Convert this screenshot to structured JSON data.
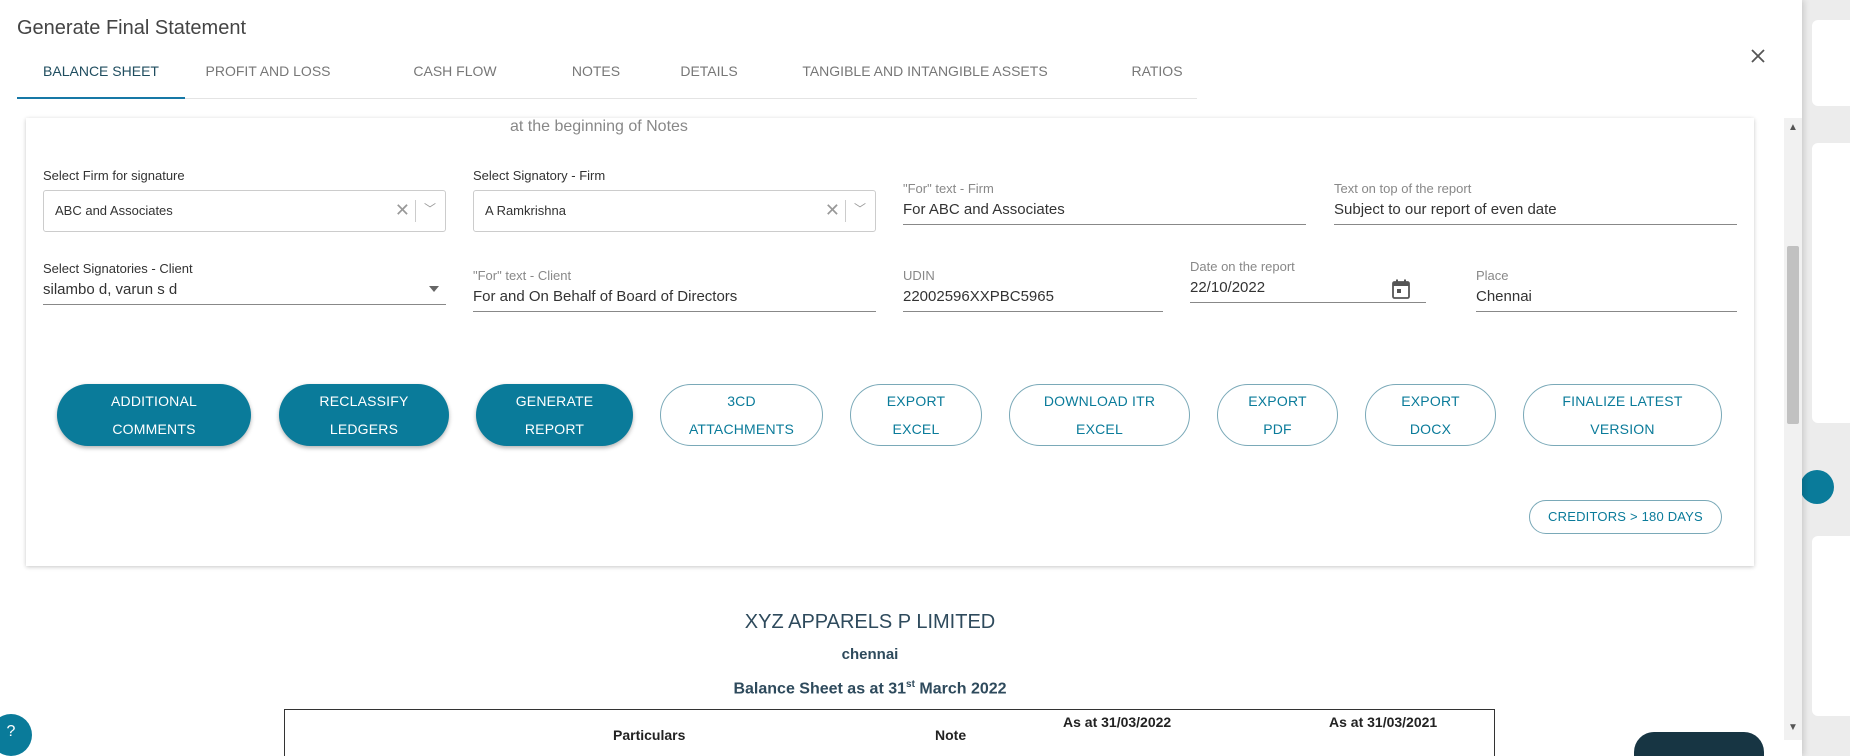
{
  "dialog": {
    "title": "Generate Final Statement",
    "close_icon": "close-icon"
  },
  "tabs": [
    {
      "label": "BALANCE SHEET",
      "active": true
    },
    {
      "label": "PROFIT AND LOSS"
    },
    {
      "label": "CASH FLOW"
    },
    {
      "label": "NOTES"
    },
    {
      "label": "DETAILS"
    },
    {
      "label": "TANGIBLE AND INTANGIBLE ASSETS"
    },
    {
      "label": "RATIOS"
    }
  ],
  "form": {
    "top_note": "at the beginning of Notes",
    "firm_for_signature": {
      "label": "Select Firm for signature",
      "value": "ABC and Associates"
    },
    "signatory_firm": {
      "label": "Select Signatory - Firm",
      "value": "A Ramkrishna"
    },
    "for_text_firm": {
      "label": "\"For\" text - Firm",
      "value": "For ABC and Associates"
    },
    "text_on_top": {
      "label": "Text on top of the report",
      "value": "Subject to our report of even date"
    },
    "signatories_client": {
      "label": "Select Signatories - Client",
      "value": "silambo d, varun s d"
    },
    "for_text_client": {
      "label": "\"For\" text - Client",
      "value": "For and On Behalf of Board of Directors"
    },
    "udin": {
      "label": "UDIN",
      "value": "22002596XXPBC5965"
    },
    "date_on_report": {
      "label": "Date on the report",
      "value": "22/10/2022"
    },
    "place": {
      "label": "Place",
      "value": "Chennai"
    }
  },
  "actions": {
    "additional_comments": [
      "ADDITIONAL",
      "COMMENTS"
    ],
    "reclassify_ledgers": [
      "RECLASSIFY",
      "LEDGERS"
    ],
    "generate_report": [
      "GENERATE",
      "REPORT"
    ],
    "attachments_3cd": [
      "3CD",
      "ATTACHMENTS"
    ],
    "export_excel": [
      "EXPORT",
      "EXCEL"
    ],
    "download_itr_excel": [
      "DOWNLOAD ITR",
      "EXCEL"
    ],
    "export_pdf": [
      "EXPORT",
      "PDF"
    ],
    "export_docx": [
      "EXPORT",
      "DOCX"
    ],
    "finalize_latest_version": [
      "FINALIZE LATEST",
      "VERSION"
    ],
    "creditors_180": "CREDITORS > 180 DAYS"
  },
  "report": {
    "company": "XYZ APPARELS P LIMITED",
    "city": "chennai",
    "heading_pre": "Balance Sheet as at 31",
    "heading_sup": "st",
    "heading_post": " March 2022",
    "columns": {
      "particulars": "Particulars",
      "note": "Note",
      "as_at_2022": "As at 31/03/2022",
      "as_at_2021": "As at 31/03/2021"
    }
  },
  "colors": {
    "accent": "#0a7b9a",
    "tab_underline": "#1678a6"
  }
}
